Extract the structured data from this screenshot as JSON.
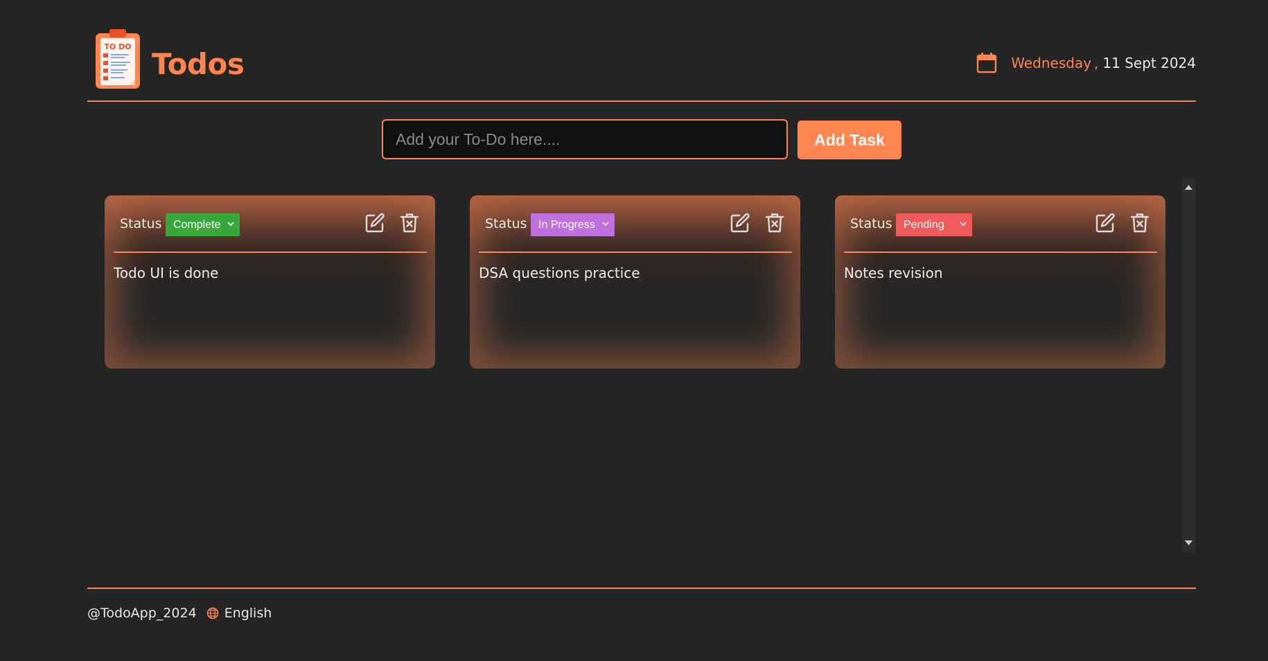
{
  "header": {
    "title": "Todos",
    "logo_text": "TO DO",
    "weekday": "Wednesday",
    "separator": ",",
    "date": "11 Sept 2024"
  },
  "input": {
    "placeholder": "Add your To-Do here....",
    "value": ""
  },
  "add_button": {
    "label": "Add Task"
  },
  "cards": [
    {
      "status_label": "Status",
      "status": "Complete",
      "status_color": "#38a83a",
      "text": "Todo UI is done",
      "edit_icon": "edit-icon",
      "delete_icon": "trash-icon"
    },
    {
      "status_label": "Status",
      "status": "In Progress",
      "status_color": "#c170e0",
      "text": "DSA questions practice",
      "edit_icon": "edit-icon",
      "delete_icon": "trash-icon"
    },
    {
      "status_label": "Status",
      "status": "Pending",
      "status_color": "#f05a5a",
      "text": "Notes revision",
      "edit_icon": "edit-icon",
      "delete_icon": "trash-icon"
    }
  ],
  "footer": {
    "copyright": "@TodoApp_2024",
    "language": "English",
    "language_icon": "globe-icon"
  },
  "colors": {
    "accent": "#ff8551",
    "background": "#252525"
  }
}
